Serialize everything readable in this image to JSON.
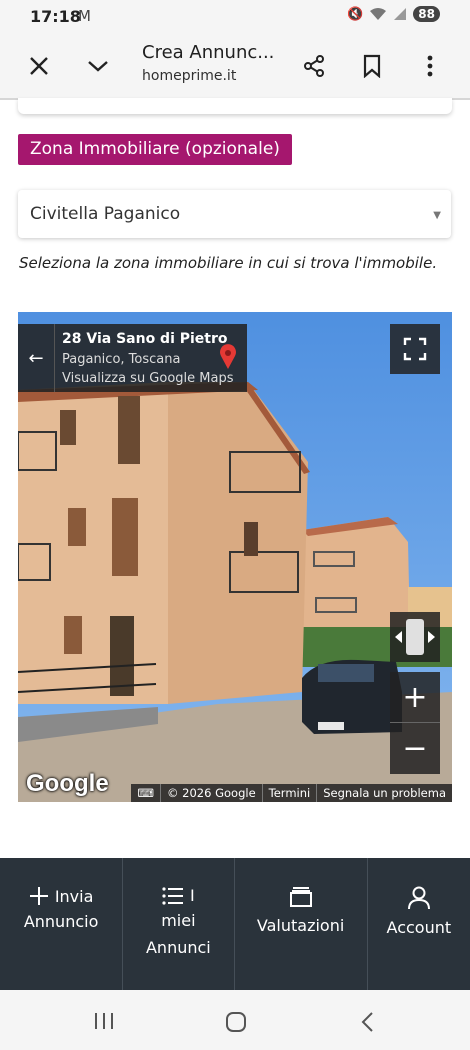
{
  "status_bar": {
    "time": "17:18",
    "battery": "88"
  },
  "browser": {
    "title": "Crea Annunc...",
    "url": "homeprime.it"
  },
  "form": {
    "zone_label": "Zona Immobiliare (opzionale)",
    "zone_value": "Civitella Paganico",
    "zone_help": "Seleziona la zona immobiliare in cui si trova l'immobile."
  },
  "street_view": {
    "address": "28 Via Sano di Pietro",
    "city": "Paganico, Toscana",
    "maps_link": "Visualizza su Google Maps",
    "logo": "Google",
    "copyright": "© 2026 Google",
    "terms": "Termini",
    "report": "Segnala un problema"
  },
  "bottom_nav": {
    "items": [
      {
        "line1": "Invia",
        "line2": "Annuncio",
        "icon": "plus-icon"
      },
      {
        "line1": "I",
        "line2": "miei",
        "line3": "Annunci",
        "icon": "list-icon"
      },
      {
        "line1": "Valutazioni",
        "icon": "archive-icon"
      },
      {
        "line1": "Account",
        "icon": "user-icon"
      }
    ]
  },
  "colors": {
    "accent": "#a5176e",
    "nav_bg": "#2a333b",
    "sky": "#5fa0e6"
  }
}
